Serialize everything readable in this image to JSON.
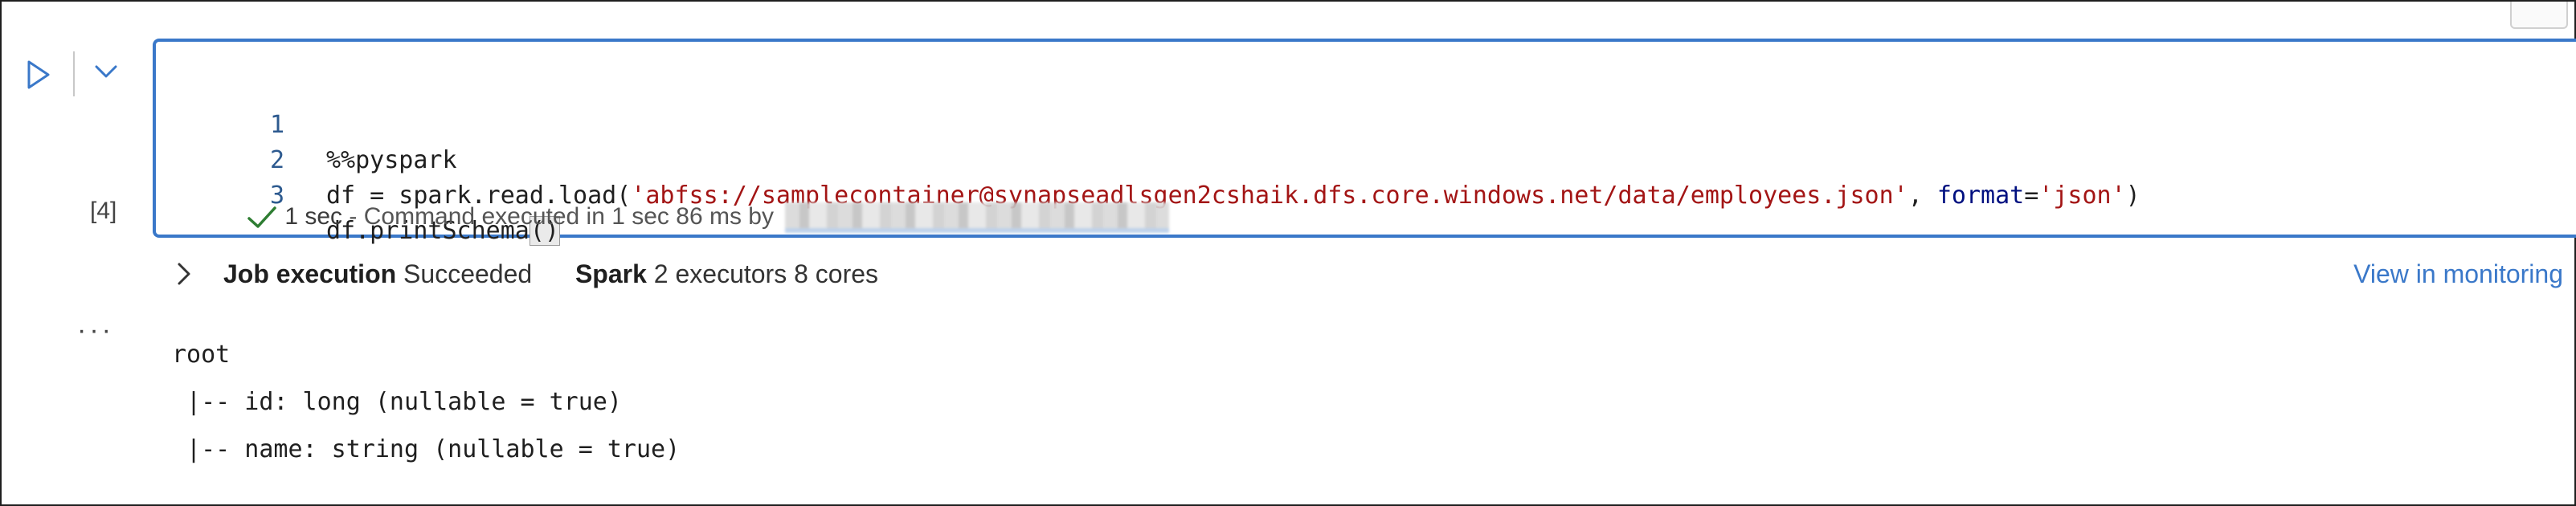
{
  "window": {
    "more_menu": "···"
  },
  "cell": {
    "execution_count": "[4]",
    "lines": [
      {
        "number": "1",
        "text": "%%pyspark"
      },
      {
        "number": "2",
        "prefix": "df = spark.read.load(",
        "path_string": "'abfss://samplecontainer@synapseadlsgen2cshaik.dfs.core.windows.net/data/employees.json'",
        "separator": ", ",
        "keyword": "format",
        "equals": "=",
        "format_string": "'json'",
        "suffix": ")"
      },
      {
        "number": "3",
        "prefix": "df.printSchema",
        "paren": "()"
      }
    ],
    "status": {
      "duration": "1 sec",
      "message": "- Command executed in 1 sec 86 ms by"
    }
  },
  "job": {
    "label": "Job execution",
    "state": "Succeeded",
    "spark_label": "Spark",
    "spark_detail": "2 executors 8 cores",
    "view_link": "View in monitoring"
  },
  "output": {
    "more_dots": "···",
    "lines": [
      "root",
      " |-- id: long (nullable = true)",
      " |-- name: string (nullable = true)"
    ]
  },
  "colors": {
    "accent": "#3a78c9",
    "string": "#a31515",
    "keyword": "#001080",
    "success": "#2e7d32"
  },
  "icons": {
    "run": "run-cell-icon",
    "collapse": "chevron-down-icon",
    "check": "checkmark-icon",
    "expand": "chevron-right-icon"
  }
}
